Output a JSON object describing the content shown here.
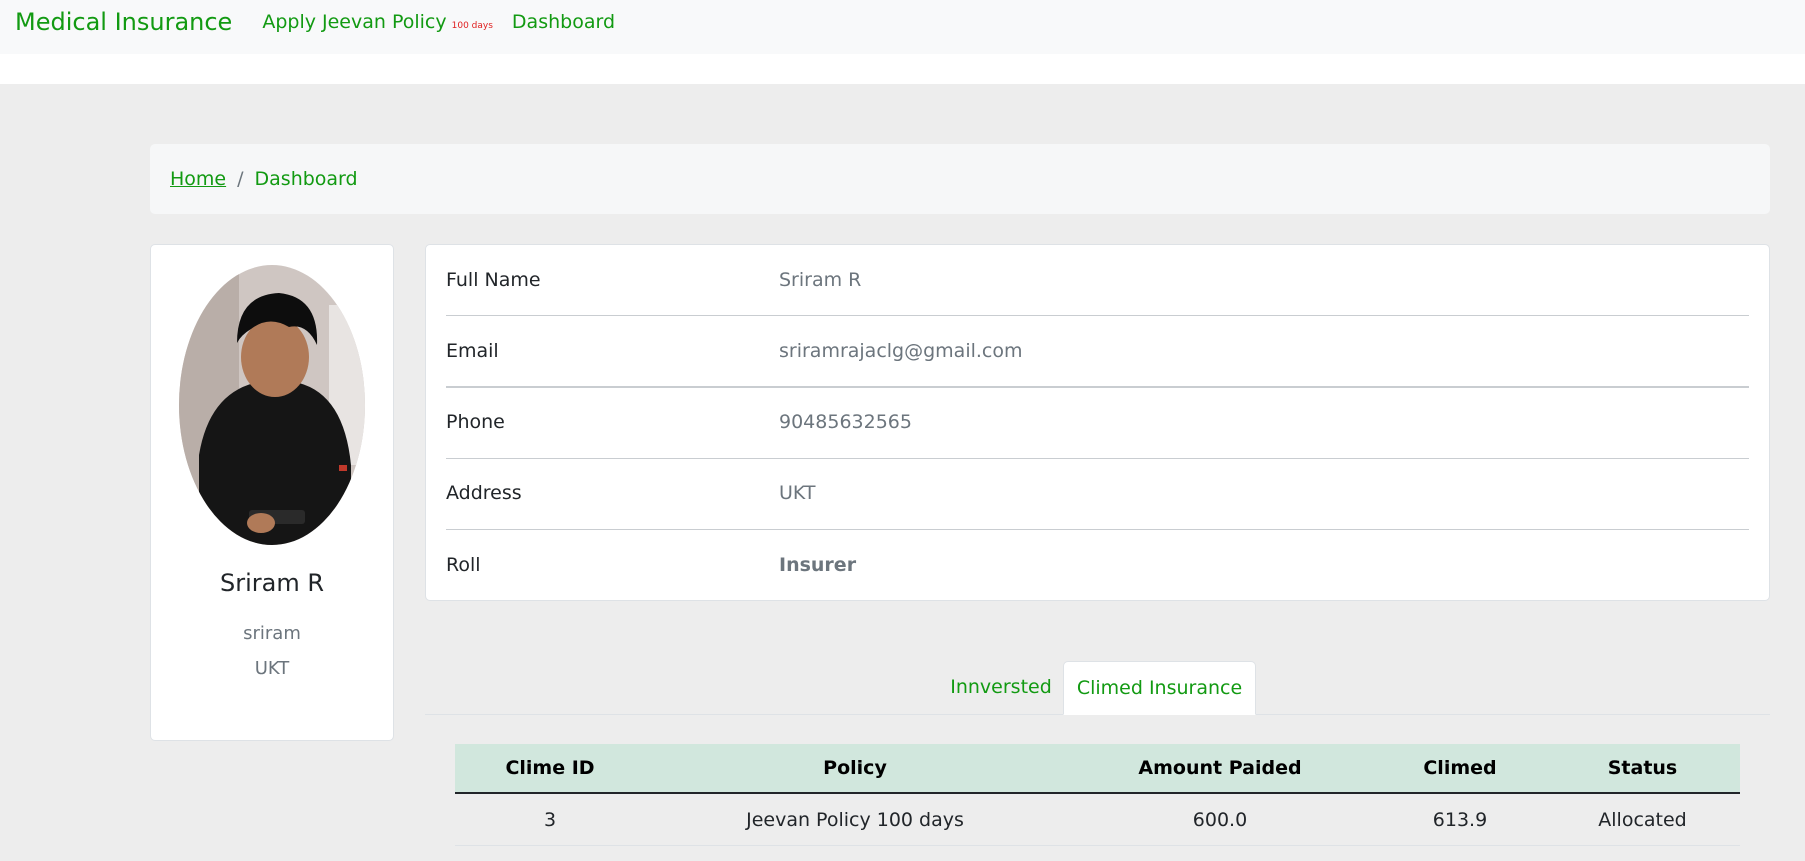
{
  "navbar": {
    "brand": "Medical Insurance",
    "apply_label": "Apply Jeevan Policy",
    "apply_badge": "100 days",
    "dashboard_label": "Dashboard"
  },
  "breadcrumb": {
    "home": "Home",
    "separator": "/",
    "current": "Dashboard"
  },
  "profile": {
    "name": "Sriram R",
    "username": "sriram",
    "address": "UKT"
  },
  "details": [
    {
      "label": "Full Name",
      "value": "Sriram R"
    },
    {
      "label": "Email",
      "value": "sriramrajaclg@gmail.com"
    },
    {
      "label": "Phone",
      "value": "90485632565"
    },
    {
      "label": "Address",
      "value": "UKT"
    },
    {
      "label": "Roll",
      "value": "Insurer"
    }
  ],
  "tabs": [
    {
      "label": "Innversted",
      "active": false
    },
    {
      "label": "Climed Insurance",
      "active": true
    }
  ],
  "table": {
    "headers": [
      "Clime ID",
      "Policy",
      "Amount Paided",
      "Climed",
      "Status"
    ],
    "rows": [
      [
        "3",
        "Jeevan Policy 100 days",
        "600.0",
        "613.9",
        "Allocated"
      ]
    ]
  },
  "colors": {
    "accent": "#129a12",
    "badge": "#e02020",
    "table_header_bg": "#d1e7dd"
  }
}
